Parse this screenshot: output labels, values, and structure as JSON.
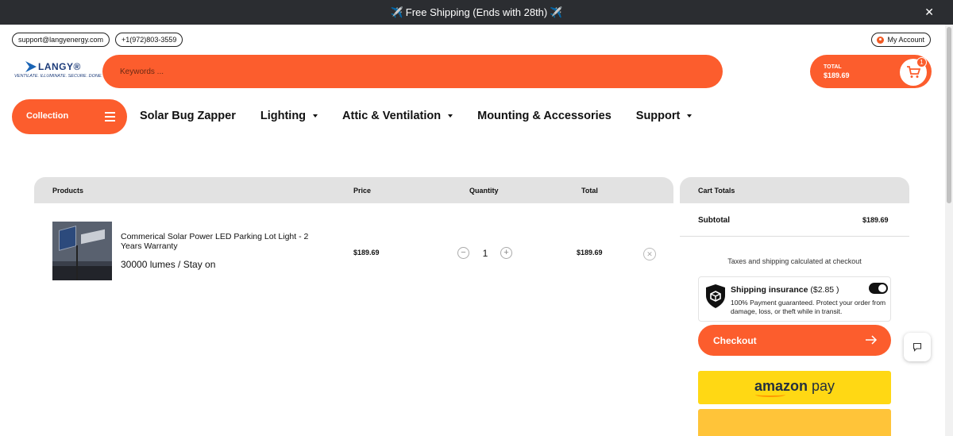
{
  "announcement": {
    "text": "Free Shipping (Ends with 28th)",
    "close_symbol": "✕"
  },
  "contact": {
    "email": "support@langyenergy.com",
    "phone": "+1(972)803-3559"
  },
  "account": {
    "label": "My Account"
  },
  "logo": {
    "brand": "LANGY®",
    "tagline": "VENTILATE. ILLUMINATE. SECURE. DONE."
  },
  "search": {
    "placeholder": "Keywords ..."
  },
  "cart": {
    "label": "TOTAL",
    "amount": "$189.69",
    "count": "1"
  },
  "nav": {
    "collection": "Collection",
    "items": [
      {
        "label": "Solar Bug Zapper",
        "dropdown": false
      },
      {
        "label": "Lighting",
        "dropdown": true
      },
      {
        "label": "Attic & Ventilation",
        "dropdown": true
      },
      {
        "label": "Mounting & Accessories",
        "dropdown": false
      },
      {
        "label": "Support",
        "dropdown": true
      }
    ]
  },
  "table": {
    "headers": {
      "products": "Products",
      "price": "Price",
      "quantity": "Quantity",
      "total": "Total"
    },
    "rows": [
      {
        "name": "Commerical Solar Power LED Parking Lot Light - 2 Years Warranty",
        "variant": "30000 lumes / Stay on",
        "price": "$189.69",
        "quantity": "1",
        "total": "$189.69"
      }
    ]
  },
  "totals": {
    "header": "Cart Totals",
    "subtotal_label": "Subtotal",
    "subtotal_value": "$189.69",
    "taxes_note": "Taxes and shipping calculated at checkout",
    "insurance_title": "Shipping insurance",
    "insurance_price": "($2.85 )",
    "insurance_desc": "100% Payment guaranteed. Protect your order from damage, loss, or theft while in transit.",
    "insurance_enabled": true,
    "checkout_label": "Checkout",
    "amazon_label_1": "amazon",
    "amazon_label_2": " pay"
  },
  "colors": {
    "accent": "#fc5d2d",
    "announce_bg": "#2b2d31",
    "amazon_yellow": "#ffd814",
    "paypal_yellow": "#ffc439"
  }
}
